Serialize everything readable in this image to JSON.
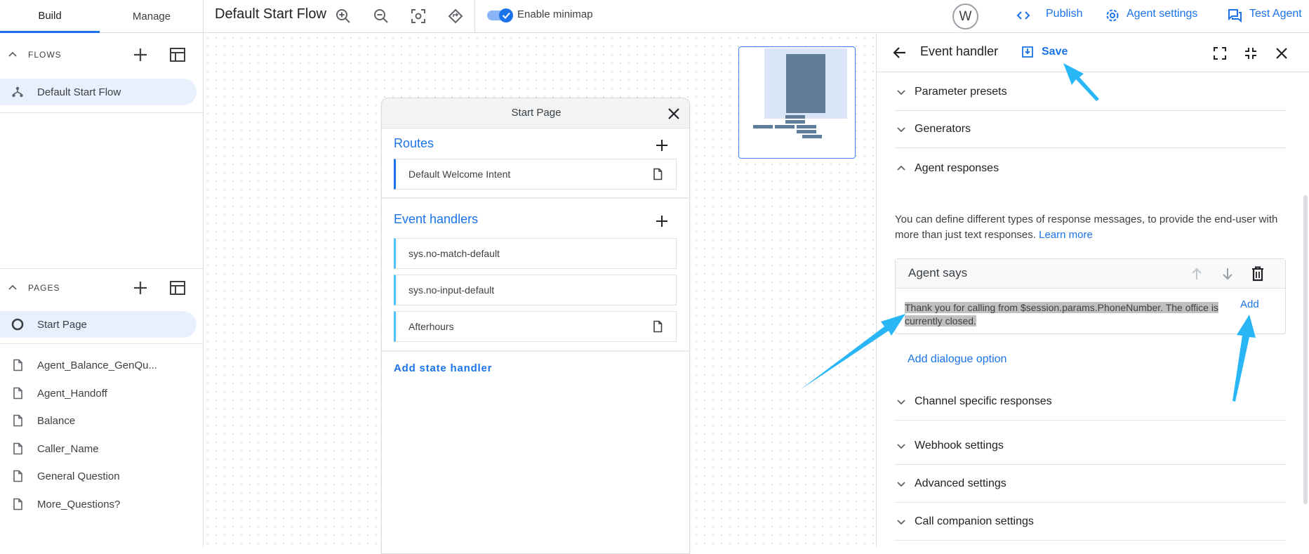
{
  "tabs": [
    {
      "label": "Build"
    },
    {
      "label": "Manage"
    }
  ],
  "flows": {
    "title": "FLOWS",
    "items": [
      {
        "label": "Default Start Flow"
      }
    ]
  },
  "pages": {
    "title": "PAGES",
    "items": [
      {
        "label": "Start Page"
      },
      {
        "label": "Agent_Balance_GenQu..."
      },
      {
        "label": "Agent_Handoff"
      },
      {
        "label": "Balance"
      },
      {
        "label": "Caller_Name"
      },
      {
        "label": "General Question"
      },
      {
        "label": "More_Questions?"
      }
    ]
  },
  "toolbar": {
    "title": "Default Start Flow",
    "minimap_label": "Enable minimap",
    "avatar": "W",
    "publish": "Publish",
    "agent_settings": "Agent settings",
    "test_agent": "Test Agent"
  },
  "start_page": {
    "title": "Start Page",
    "routes_title": "Routes",
    "routes": [
      {
        "label": "Default Welcome Intent"
      }
    ],
    "event_title": "Event handlers",
    "events": [
      {
        "label": "sys.no-match-default"
      },
      {
        "label": "sys.no-input-default"
      },
      {
        "label": "Afterhours"
      }
    ],
    "add_state_handler": "Add state handler"
  },
  "panel": {
    "title": "Event handler",
    "save": "Save",
    "sections": [
      {
        "label": "Parameter presets"
      },
      {
        "label": "Generators"
      },
      {
        "label": "Agent responses"
      },
      {
        "label": "Channel specific responses"
      },
      {
        "label": "Webhook settings"
      },
      {
        "label": "Advanced settings"
      },
      {
        "label": "Call companion settings"
      }
    ],
    "description": "You can define different types of response messages, to provide the end-user with more than just text responses.",
    "learn_more": "Learn more",
    "agent_says": {
      "title": "Agent says",
      "text": "Thank you for calling from $session.params.PhoneNumber. The office is currently closed.",
      "add": "Add"
    },
    "add_dialogue": "Add dialogue option"
  },
  "colors": {
    "accent": "#1a73e8",
    "annotation_arrow": "#29b6f6",
    "active_bg": "#e8f0fe"
  }
}
